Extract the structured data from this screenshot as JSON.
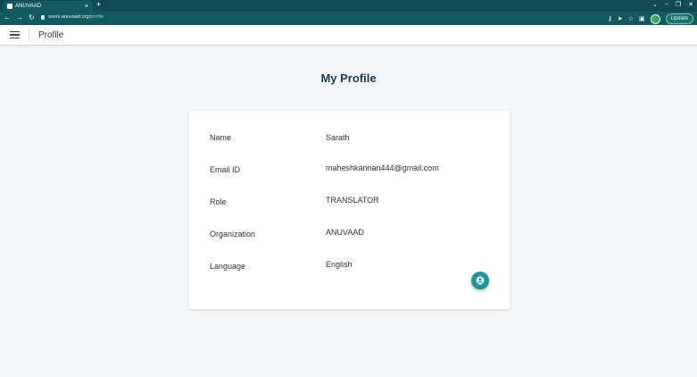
{
  "browser": {
    "tab_title": "ANUVAAD",
    "tab_close": "×",
    "new_tab": "+",
    "url_host": "users.anuvaad.org",
    "url_path": "/profile",
    "update_label": "Update"
  },
  "header": {
    "title": "Profile"
  },
  "page": {
    "heading": "My Profile"
  },
  "profile": {
    "fields": [
      {
        "label": "Name",
        "value": "Sarath"
      },
      {
        "label": "Email ID",
        "value": "maheshkannan444@gmail.com"
      },
      {
        "label": "Role",
        "value": "TRANSLATOR"
      },
      {
        "label": "Organization",
        "value": "ANUVAAD"
      },
      {
        "label": "Language",
        "value": "English"
      }
    ]
  },
  "colors": {
    "chrome_dark": "#0e4b50",
    "chrome_toolbar": "#125a5f",
    "fab": "#1a97a0",
    "heading": "#1c3a57",
    "page_bg": "#f4f6f8"
  },
  "icons": [
    "menu-icon",
    "back-icon",
    "forward-icon",
    "reload-icon",
    "lock-icon",
    "key-icon",
    "send-icon",
    "star-icon",
    "sidebar-icon",
    "profile-icon",
    "chevron-down-icon",
    "minimize-icon",
    "restore-icon",
    "close-icon",
    "account-circle-icon"
  ]
}
